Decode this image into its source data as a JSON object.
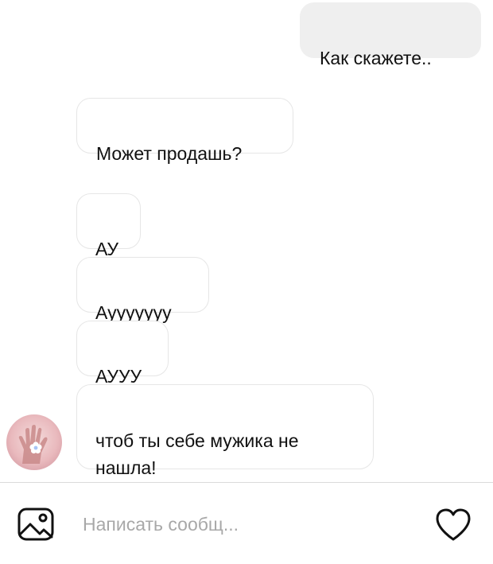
{
  "messages": [
    {
      "id": "out-1",
      "direction": "outgoing",
      "text": "Как скажете.."
    },
    {
      "id": "in-1",
      "direction": "incoming",
      "text": "Может продашь?"
    },
    {
      "id": "in-2",
      "direction": "incoming",
      "text": "АУ"
    },
    {
      "id": "in-3",
      "direction": "incoming",
      "text": "Аууууууу"
    },
    {
      "id": "in-4",
      "direction": "incoming",
      "text": "АУУУ"
    },
    {
      "id": "in-5",
      "direction": "incoming",
      "text": "чтоб ты себе мужика не\nнашла!"
    }
  ],
  "composer": {
    "placeholder": "Написать сообщ...",
    "value": "",
    "left_icon": "image-gallery-icon",
    "right_icon": "heart-icon"
  },
  "avatar": {
    "icon": "hand-with-flower-avatar"
  },
  "colors": {
    "outgoing_bubble": "#efefef",
    "incoming_bubble_border": "#e6e6e6",
    "placeholder": "#a8a8a8",
    "divider": "#dbdbdb"
  }
}
